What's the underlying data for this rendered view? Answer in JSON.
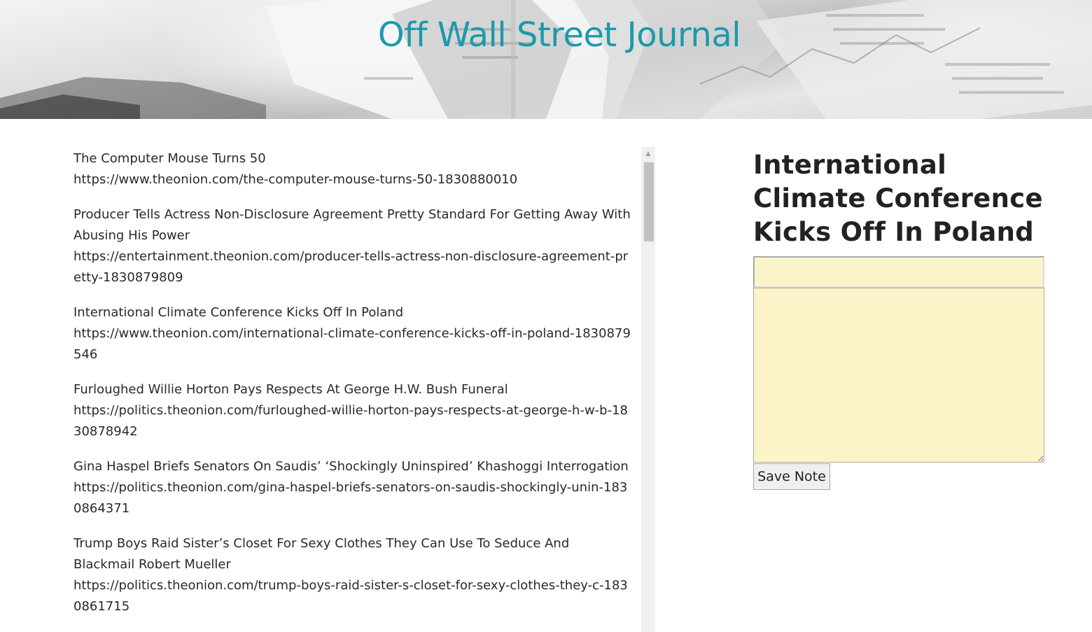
{
  "header": {
    "title": "Off Wall Street Journal",
    "title_color": "#1b9aaa"
  },
  "articles": [
    {
      "headline": "The Computer Mouse Turns 50",
      "url": "https://www.theonion.com/the-computer-mouse-turns-50-1830880010"
    },
    {
      "headline": "Producer Tells Actress Non-Disclosure Agreement Pretty Standard For Getting Away With Abusing His Power",
      "url": "https://entertainment.theonion.com/producer-tells-actress-non-disclosure-agreement-pretty-1830879809"
    },
    {
      "headline": "International Climate Conference Kicks Off In Poland",
      "url": "https://www.theonion.com/international-climate-conference-kicks-off-in-poland-1830879546"
    },
    {
      "headline": "Furloughed Willie Horton Pays Respects At George H.W. Bush Funeral",
      "url": "https://politics.theonion.com/furloughed-willie-horton-pays-respects-at-george-h-w-b-1830878942"
    },
    {
      "headline": "Gina Haspel Briefs Senators On Saudis’ ‘Shockingly Uninspired’ Khashoggi Interrogation",
      "url": "https://politics.theonion.com/gina-haspel-briefs-senators-on-saudis-shockingly-unin-1830864371"
    },
    {
      "headline": "Trump Boys Raid Sister’s Closet For Sexy Clothes They Can Use To Seduce And Blackmail Robert Mueller",
      "url": "https://politics.theonion.com/trump-boys-raid-sister-s-closet-for-sexy-clothes-they-c-1830861715"
    }
  ],
  "note": {
    "title": "International Climate Conference Kicks Off In Poland",
    "title_input_value": "",
    "body_value": "",
    "save_label": "Save Note",
    "note_background": "#fbf4c8"
  }
}
